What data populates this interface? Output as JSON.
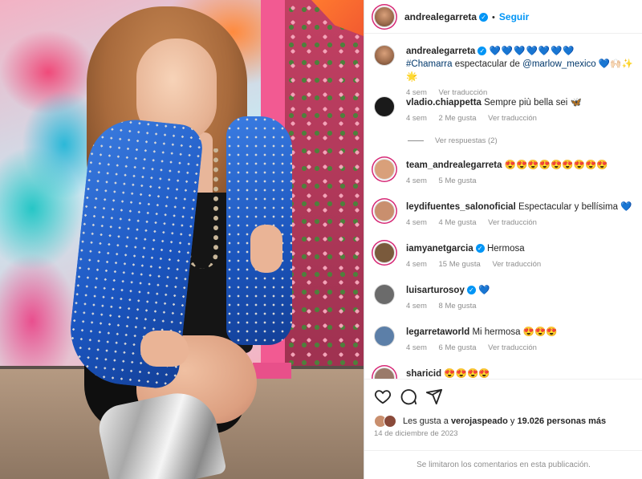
{
  "post": {
    "author": "andrealegarreta",
    "follow_label": "Seguir",
    "separator": "•"
  },
  "caption": {
    "username": "andrealegarreta",
    "hearts": "💙💙💙💙💙💙💙",
    "hashtag": "#Chamarra",
    "text": "espectacular de",
    "mention": "@marlow_mexico",
    "emojis": "💙🙌🏻✨🌟",
    "time": "4 sem",
    "translate": "Ver traducción"
  },
  "comments": [
    {
      "username": "vladio.chiappetta",
      "verified": false,
      "text": "Sempre più bella sei 🦋",
      "time": "4 sem",
      "likes": "2 Me gusta",
      "translate": "Ver traducción",
      "avatar_color": "#1a1a1a"
    },
    {
      "username": "team_andrealegarreta",
      "verified": false,
      "text": "😍😍😍😍😍😍😍😍😍",
      "time": "4 sem",
      "likes": "5 Me gusta",
      "translate": "",
      "avatar_color": "#d9a07a"
    },
    {
      "username": "leydifuentes_salonoficial",
      "verified": false,
      "text": "Espectacular y bellísima 💙",
      "time": "4 sem",
      "likes": "4 Me gusta",
      "translate": "Ver traducción",
      "avatar_color": "#c98f6e"
    },
    {
      "username": "iamyanetgarcia",
      "verified": true,
      "text": "Hermosa",
      "time": "4 sem",
      "likes": "15 Me gusta",
      "translate": "Ver traducción",
      "avatar_color": "#7a5a3c"
    },
    {
      "username": "luisarturosoy",
      "verified": true,
      "text": "💙",
      "time": "4 sem",
      "likes": "8 Me gusta",
      "translate": "",
      "avatar_color": "#6b6b6b"
    },
    {
      "username": "legarretaworld",
      "verified": false,
      "text": "Mi hermosa 😍😍😍",
      "time": "4 sem",
      "likes": "6 Me gusta",
      "translate": "Ver traducción",
      "avatar_color": "#5c7fa8"
    },
    {
      "username": "sharicid",
      "verified": false,
      "text": "😍😍😍😍",
      "time": "",
      "likes": "",
      "translate": "",
      "avatar_color": "#9a7a6a"
    }
  ],
  "view_replies": "Ver respuestas (2)",
  "likes_summary": {
    "prefix": "Les gusta a",
    "user": "verojaspeado",
    "conj": "y",
    "others": "19.026 personas más"
  },
  "date": "14 de diciembre de 2023",
  "comments_limited": "Se limitaron los comentarios en esta publicación.",
  "colors": {
    "link": "#0095f6",
    "verified": "#0095f6",
    "muted": "#8e8e8e"
  },
  "icons": [
    "heart-icon",
    "comment-icon",
    "share-icon"
  ]
}
